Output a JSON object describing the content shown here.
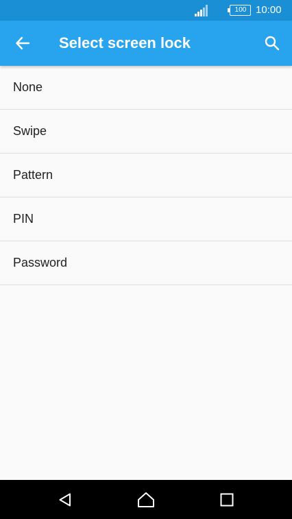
{
  "status_bar": {
    "battery_level": "100",
    "clock": "10:00",
    "icons": [
      "signal-icon",
      "battery-icon"
    ]
  },
  "app_bar": {
    "title": "Select screen lock",
    "icons": [
      "back-arrow-icon",
      "search-icon"
    ]
  },
  "options": [
    {
      "label": "None"
    },
    {
      "label": "Swipe"
    },
    {
      "label": "Pattern"
    },
    {
      "label": "PIN"
    },
    {
      "label": "Password"
    }
  ],
  "nav_bar": {
    "icons": [
      "back-triangle-icon",
      "home-icon",
      "recents-square-icon"
    ]
  },
  "colors": {
    "status_bar": "#1b8fd6",
    "app_bar": "#28a3ed",
    "background": "#fafafa",
    "nav_bar": "#000000"
  }
}
